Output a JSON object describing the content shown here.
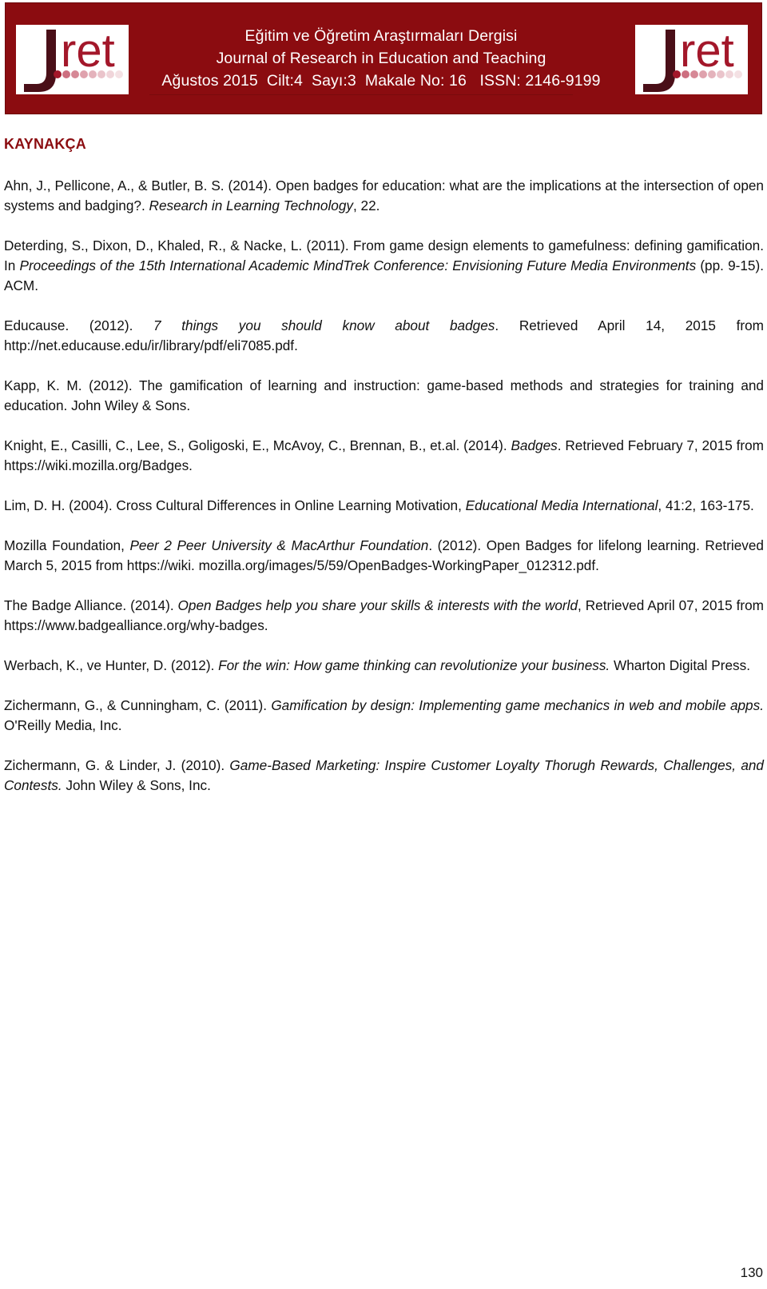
{
  "header": {
    "logo_text": "Jret",
    "title_tr": "Eğitim ve Öğretim Araştırmaları Dergisi",
    "title_en": "Journal of Research in Education and Teaching",
    "issue_line": "Ağustos 2015  Cilt:4  Sayı:3  Makale No: 16   ISSN: 2146-9199",
    "brand_color": "#8b0c10"
  },
  "section": {
    "heading": "KAYNAKÇA"
  },
  "references": [
    {
      "parts": [
        {
          "text": "Ahn, J., Pellicone, A., & Butler, B. S. (2014). Open badges for education: what are the implications at the intersection of open systems and badging?. ",
          "italic": false
        },
        {
          "text": "Research in Learning Technology",
          "italic": true
        },
        {
          "text": ", 22.",
          "italic": false
        }
      ]
    },
    {
      "parts": [
        {
          "text": "Deterding, S., Dixon, D., Khaled, R., & Nacke, L. (2011). From game design elements to gamefulness: defining gamification. In ",
          "italic": false
        },
        {
          "text": "Proceedings of the 15th International Academic MindTrek Conference: Envisioning Future Media Environments",
          "italic": true
        },
        {
          "text": " (pp. 9-15). ACM.",
          "italic": false
        }
      ]
    },
    {
      "parts": [
        {
          "text": "Educause. (2012). ",
          "italic": false
        },
        {
          "text": "7 things you should know about badges",
          "italic": true
        },
        {
          "text": ". Retrieved April 14, 2015 from http://net.educause.edu/ir/library/pdf/eli7085.pdf.",
          "italic": false
        }
      ]
    },
    {
      "parts": [
        {
          "text": "Kapp, K. M. (2012). The gamification of learning and instruction: game-based methods and strategies for training and education. John Wiley & Sons.",
          "italic": false
        }
      ]
    },
    {
      "parts": [
        {
          "text": "Knight, E., Casilli, C., Lee, S., Goligoski, E.,  McAvoy, C., Brennan, B., et.al. (2014). ",
          "italic": false
        },
        {
          "text": "Badges",
          "italic": true
        },
        {
          "text": ". Retrieved February 7, 2015 from https://wiki.mozilla.org/Badges.",
          "italic": false
        }
      ]
    },
    {
      "parts": [
        {
          "text": "Lim, D. H. (2004). Cross Cultural Differences in Online Learning Motivation, ",
          "italic": false
        },
        {
          "text": "Educational Media International",
          "italic": true
        },
        {
          "text": ", 41:2, 163-175.",
          "italic": false
        }
      ]
    },
    {
      "parts": [
        {
          "text": "Mozilla Foundation, ",
          "italic": false
        },
        {
          "text": "Peer 2 Peer University & MacArthur Foundation",
          "italic": true
        },
        {
          "text": ". (2012). Open Badges for lifelong learning. Retrieved March 5, 2015 from https://wiki. mozilla.org/images/5/59/OpenBadges-WorkingPaper_012312.pdf.",
          "italic": false
        }
      ]
    },
    {
      "parts": [
        {
          "text": "The Badge Alliance. (2014). ",
          "italic": false
        },
        {
          "text": "Open Badges help you share your skills & interests with the world",
          "italic": true
        },
        {
          "text": ", Retrieved April 07, 2015 from https://www.badgealliance.org/why-badges.",
          "italic": false
        }
      ]
    },
    {
      "parts": [
        {
          "text": "Werbach, K., ve Hunter, D. (2012). ",
          "italic": false
        },
        {
          "text": "For the win: How game thinking can revolutionize your business.",
          "italic": true
        },
        {
          "text": " Wharton Digital Press.",
          "italic": false
        }
      ]
    },
    {
      "parts": [
        {
          "text": "Zichermann, G., & Cunningham, C. (2011). ",
          "italic": false
        },
        {
          "text": "Gamification by design: Implementing game mechanics in web and mobile apps.",
          "italic": true
        },
        {
          "text": " O'Reilly Media, Inc.",
          "italic": false
        }
      ]
    },
    {
      "parts": [
        {
          "text": "Zichermann, G. & Linder, J. (2010). ",
          "italic": false
        },
        {
          "text": "Game-Based Marketing: Inspire Customer Loyalty Thorugh Rewards, Challenges, and Contests.",
          "italic": true
        },
        {
          "text": " John Wiley & Sons, Inc.",
          "italic": false
        }
      ]
    }
  ],
  "footer": {
    "page_number": "130"
  }
}
